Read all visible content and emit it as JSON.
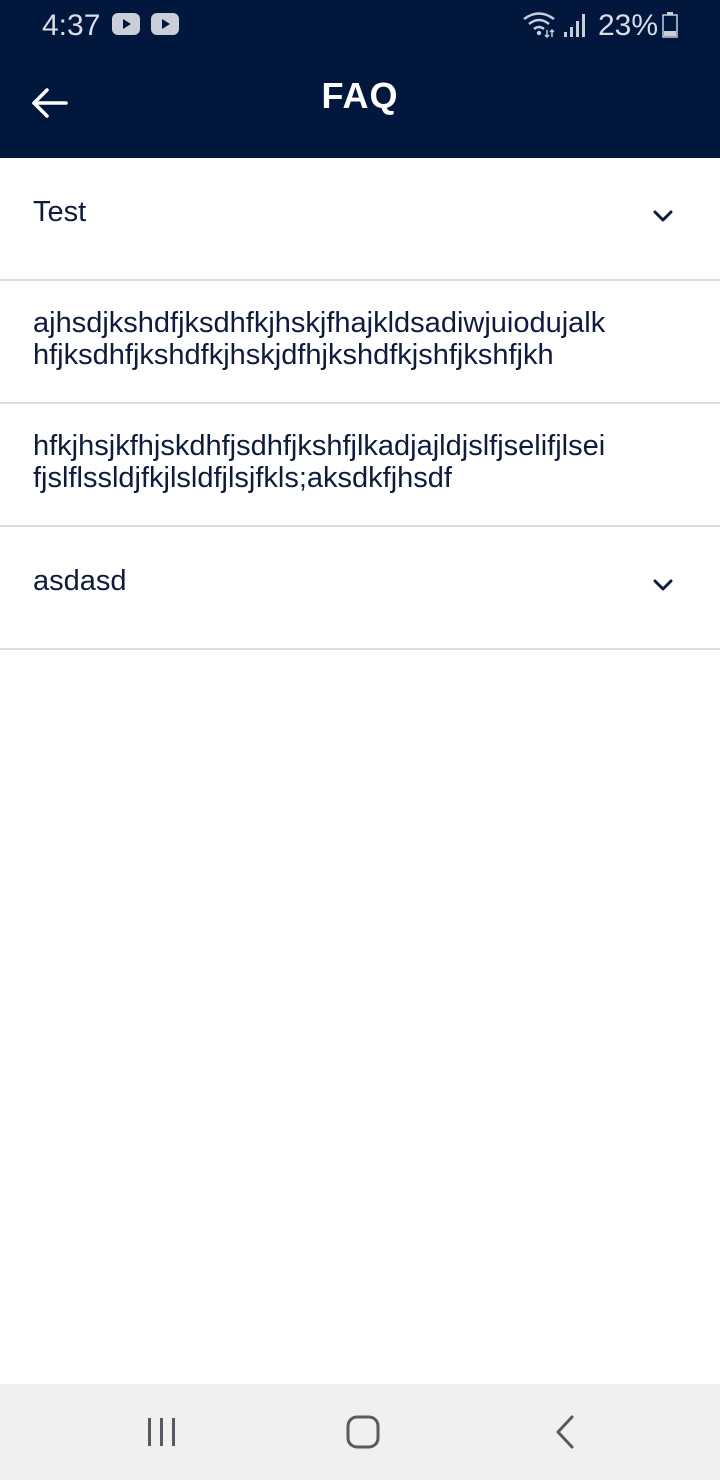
{
  "status_bar": {
    "time": "4:37",
    "battery": "23%",
    "icons": [
      "youtube-icon",
      "youtube-icon",
      "wifi-icon",
      "signal-icon",
      "battery-icon"
    ]
  },
  "app_bar": {
    "title": "FAQ",
    "back_icon": "back-arrow-icon",
    "background": "#01173d"
  },
  "faq": {
    "items": [
      {
        "lines": [
          "Test"
        ]
      },
      {
        "lines": [
          "ajhsdjkshdfjksdhfkjhskjfhajkldsadiwjuiodujalk",
          "hfjksdhfjkshdfkjhskjdfhjkshdfkjshfjkshfjkh"
        ]
      },
      {
        "lines": [
          "hfkjhsjkfhjskdhfjsdhfjkshfjlkadjajldjslfjselifjlsei",
          "fjslflssldjfkjlsldfjlsjfkls;aksdkfjhsdf"
        ]
      },
      {
        "lines": [
          "asdasd"
        ]
      }
    ],
    "text_color": "#0f1b3d",
    "divider_color": "#dedede"
  },
  "nav_bar": {
    "icons": [
      "recent-apps-icon",
      "home-icon",
      "back-icon"
    ],
    "background": "#f0f0f0"
  }
}
